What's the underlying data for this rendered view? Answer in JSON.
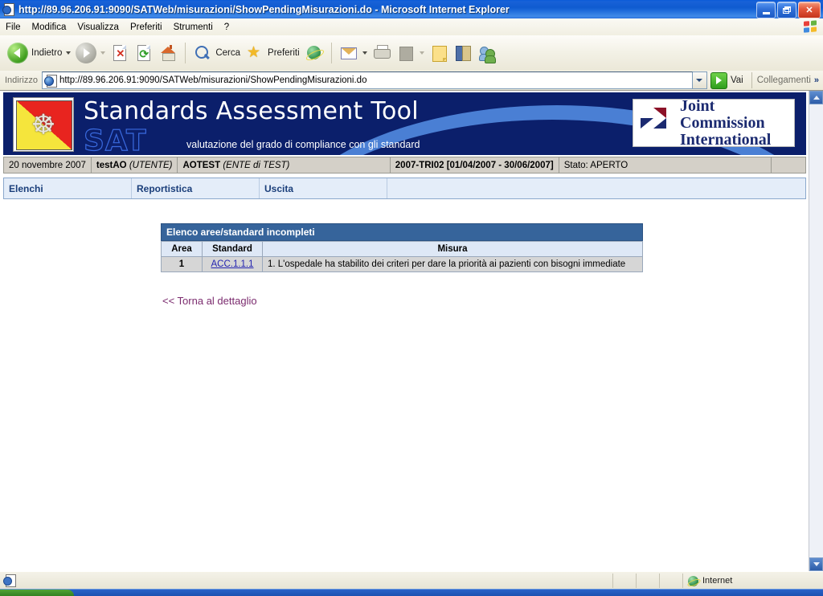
{
  "window": {
    "title": "http://89.96.206.91:9090/SATWeb/misurazioni/ShowPendingMisurazioni.do - Microsoft Internet Explorer",
    "minimize_label": "Minimize",
    "restore_label": "Restore",
    "close_label": "Close"
  },
  "menu": {
    "items": [
      {
        "label": "File"
      },
      {
        "label": "Modifica"
      },
      {
        "label": "Visualizza"
      },
      {
        "label": "Preferiti"
      },
      {
        "label": "Strumenti"
      },
      {
        "label": "?"
      }
    ]
  },
  "toolbar": {
    "back_label": "Indietro",
    "forward_label": "Avanti",
    "stop_label": "Interrompi",
    "refresh_label": "Aggiorna",
    "home_label": "Pagina iniziale",
    "search_label": "Cerca",
    "favorites_label": "Preferiti",
    "media_label": "Multimedia",
    "mail_label": "Posta",
    "print_label": "Stampa",
    "edit_label": "Modifica",
    "notes_label": "Note",
    "research_label": "Ricerca",
    "messenger_label": "Messenger"
  },
  "address": {
    "label": "Indirizzo",
    "value": "http://89.96.206.91:9090/SATWeb/misurazioni/ShowPendingMisurazioni.do",
    "go_label": "Vai",
    "links_label": "Collegamenti",
    "chevrons": "»"
  },
  "banner": {
    "title": "Standards Assessment Tool",
    "watermark": "SAT",
    "subtitle": "valutazione del grado di compliance con gli standard",
    "crest_name": "trinacria-crest",
    "jci_line1": "Joint Commission",
    "jci_line2": "International"
  },
  "infobar": {
    "date": "20 novembre 2007",
    "user_name": "testAO",
    "user_role": "(UTENTE)",
    "entity_name": "AOTEST",
    "entity_role": "(ENTE di TEST)",
    "period": "2007-TRI02 [01/04/2007 - 30/06/2007]",
    "status": "Stato: APERTO"
  },
  "nav": {
    "items": [
      {
        "label": "Elenchi"
      },
      {
        "label": "Reportistica"
      },
      {
        "label": "Uscita"
      }
    ]
  },
  "main": {
    "panel_title": "Elenco aree/standard incompleti",
    "columns": [
      "Area",
      "Standard",
      "Misura"
    ],
    "rows": [
      {
        "area": "1",
        "standard": "ACC.1.1.1",
        "misura": "1. L'ospedale ha stabilito dei criteri per dare la priorità ai pazienti con bisogni immediate"
      }
    ],
    "back_link": "<< Torna al dettaglio"
  },
  "statusbar": {
    "message": "",
    "zone": "Internet"
  },
  "colors": {
    "titlebar_blue": "#1862d8",
    "banner_navy": "#0b1f6b",
    "panel_header": "#36649b",
    "nav_blue": "#e4edf9",
    "link_blue": "#2323b0",
    "visited_link": "#7b2b6e"
  }
}
